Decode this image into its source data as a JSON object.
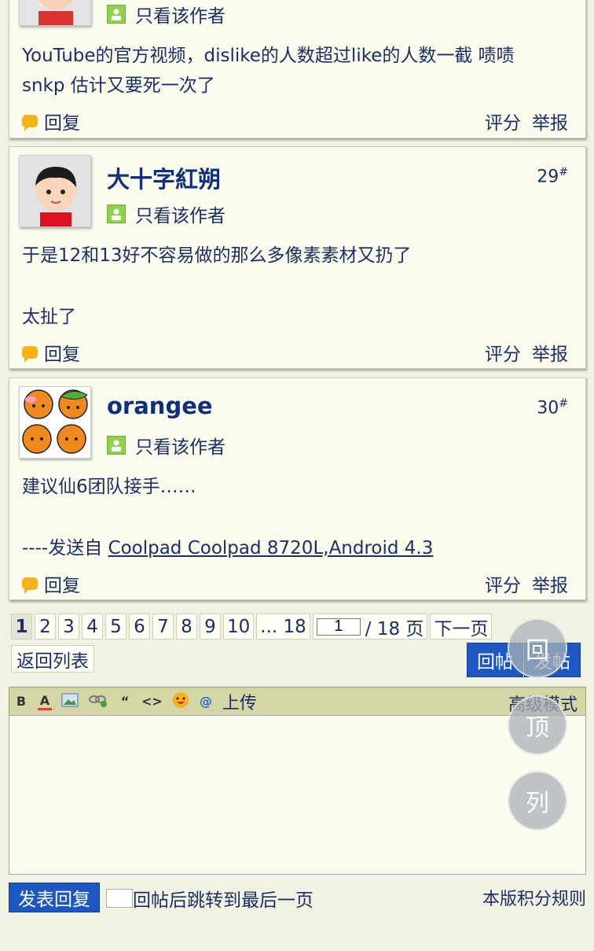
{
  "posts": [
    {
      "author": "",
      "floor": "",
      "only_author": "只看该作者",
      "lines": [
        "YouTube的官方视频，dislike的人数超过like的人数一截 啧啧",
        "snkp 估计又要死一次了"
      ],
      "reply": "回复",
      "rate": "评分",
      "report": "举报"
    },
    {
      "author": "大十字紅朔",
      "floor": "29",
      "only_author": "只看该作者",
      "lines": [
        "于是12和13好不容易做的那么多像素素材又扔了",
        "太扯了"
      ],
      "reply": "回复",
      "rate": "评分",
      "report": "举报"
    },
    {
      "author": "orangee",
      "floor": "30",
      "only_author": "只看该作者",
      "lines": [
        "建议仙6团队接手……",
        "----发送自 "
      ],
      "link": "Coolpad Coolpad 8720L,Android 4.3",
      "reply": "回复",
      "rate": "评分",
      "report": "举报"
    }
  ],
  "floor_mark": "#",
  "pager": {
    "pages": [
      "1",
      "2",
      "3",
      "4",
      "5",
      "6",
      "7",
      "8",
      "9",
      "10"
    ],
    "current": "1",
    "ellipsis_last": "... 18",
    "input_value": "1",
    "total": "/ 18 页",
    "next": "下一页",
    "back": "返回列表"
  },
  "buttons": {
    "reply_post": "回帖",
    "new_post": "发帖",
    "submit": "发表回复",
    "jump_last": "回帖后跳转到最后一页",
    "rules": "本版积分规则"
  },
  "editor": {
    "tools": [
      "B",
      "A",
      "img",
      "link",
      "quote",
      "code",
      "emoji",
      "@"
    ],
    "upload": "上传",
    "advanced": "高级模式"
  },
  "floating": {
    "reply": "回",
    "top": "顶",
    "list": "列"
  },
  "colors": {
    "background": "#f2f2e2",
    "accent": "#1e57c2",
    "text": "#1a2f66"
  }
}
